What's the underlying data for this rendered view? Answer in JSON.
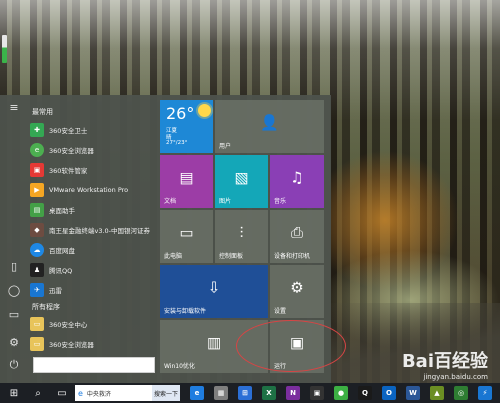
{
  "start_menu": {
    "common_header": "最常用",
    "all_programs_header": "所有程序",
    "common_apps": [
      {
        "label": "360安全卫士",
        "icon": "360-safe-guard-icon",
        "color": "#34a853"
      },
      {
        "label": "360安全浏览器",
        "icon": "360-browser-icon",
        "color": "#4caf50"
      },
      {
        "label": "360软件管家",
        "icon": "360-software-manager-icon",
        "color": "#e53935"
      },
      {
        "label": "VMware Workstation Pro",
        "icon": "vmware-icon",
        "color": "#f5a623"
      },
      {
        "label": "桌面助手",
        "icon": "desktop-assistant-icon",
        "color": "#43a047"
      },
      {
        "label": "南王星金融终端v3.0-中国银河证券",
        "icon": "finance-terminal-icon",
        "color": "#6d4c41"
      },
      {
        "label": "百度网盘",
        "icon": "baidu-netdisk-icon",
        "color": "#1e88e5"
      },
      {
        "label": "腾讯QQ",
        "icon": "qq-penguin-icon",
        "color": "#222222"
      },
      {
        "label": "迅雷",
        "icon": "thunder-icon",
        "color": "#1976d2"
      }
    ],
    "all_apps": [
      {
        "label": "360安全中心",
        "icon": "folder-icon",
        "color": "#e8c45a"
      },
      {
        "label": "360安全浏览器",
        "icon": "folder-icon",
        "color": "#e8c45a"
      }
    ],
    "search_value": ""
  },
  "tiles": {
    "weather": {
      "temp": "26°",
      "city": "江夏",
      "condition": "晴",
      "range": "27°/23°",
      "color": "#1e88d6"
    },
    "user": {
      "label": "用户",
      "icon": "user-icon"
    },
    "documents": {
      "label": "文档",
      "icon": "document-icon",
      "color": "#9c3da6"
    },
    "pictures": {
      "label": "图片",
      "icon": "picture-icon",
      "color": "#14a7b8"
    },
    "music": {
      "label": "音乐",
      "icon": "headphones-icon",
      "color": "#8a3fb5"
    },
    "this_pc": {
      "label": "此电脑",
      "icon": "computer-icon"
    },
    "control_panel": {
      "label": "控制面板",
      "icon": "sliders-icon"
    },
    "devices": {
      "label": "设备和打印机",
      "icon": "printer-icon"
    },
    "install": {
      "label": "安装与卸载软件",
      "icon": "install-icon",
      "color": "#1f4f97"
    },
    "settings": {
      "label": "设置",
      "icon": "gear-icon"
    },
    "win10": {
      "label": "Win10优化",
      "icon": "panel-icon"
    },
    "run": {
      "label": "运行",
      "icon": "run-icon"
    }
  },
  "taskbar": {
    "search_text": "中央救济",
    "search_button": "搜索一下",
    "apps": [
      {
        "icon": "edge-icon",
        "color": "#1f7de0",
        "glyph": "e"
      },
      {
        "icon": "store-icon",
        "color": "#7f7f7f",
        "glyph": "▦"
      },
      {
        "icon": "windows-store-icon",
        "color": "#2b6fd6",
        "glyph": "⊞"
      },
      {
        "icon": "excel-icon",
        "color": "#1e7145",
        "glyph": "X"
      },
      {
        "icon": "onenote-icon",
        "color": "#7b2e9e",
        "glyph": "N"
      },
      {
        "icon": "terminal-icon",
        "color": "#333333",
        "glyph": "▣"
      },
      {
        "icon": "browser-icon",
        "color": "#3cb043",
        "glyph": "●"
      },
      {
        "icon": "qq-icon",
        "color": "#1a1a1a",
        "glyph": "Q"
      },
      {
        "icon": "outlook-icon",
        "color": "#0a64c1",
        "glyph": "O"
      },
      {
        "icon": "word-icon",
        "color": "#2b5797",
        "glyph": "W"
      },
      {
        "icon": "photos-icon",
        "color": "#6b8e23",
        "glyph": "▲"
      },
      {
        "icon": "security-icon",
        "color": "#2e7d32",
        "glyph": "◎"
      },
      {
        "icon": "thunder-icon",
        "color": "#1976d2",
        "glyph": "⚡"
      }
    ]
  },
  "watermark": {
    "brand": "Bai百经验",
    "url": "jingyan.baidu.com"
  }
}
